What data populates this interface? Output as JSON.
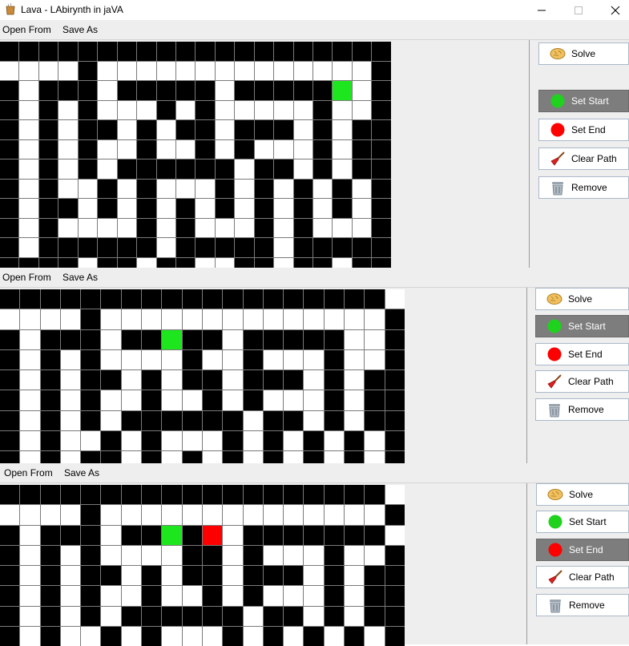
{
  "window": {
    "title": "Lava - LAbirynth in jaVA"
  },
  "menu": {
    "open_label": "Open From",
    "save_label": "Save As"
  },
  "buttons": {
    "solve": "Solve",
    "set_start": "Set Start",
    "set_end": "Set End",
    "clear_path": "Clear Path",
    "remove": "Remove"
  },
  "colors": {
    "wall": "#000000",
    "floor": "#ffffff",
    "start": "#1ee61e",
    "end": "#ff0000",
    "selected_button": "#7d7d7d"
  },
  "icons": {
    "app": "cup-icon",
    "solve": "brain-icon",
    "set_start": "green-dot-icon",
    "set_end": "red-dot-icon",
    "clear_path": "broom-icon",
    "remove": "trash-icon"
  },
  "panels": [
    {
      "selected": "set_start",
      "maze": {
        "rows": [
          "####################",
          "....#..............#",
          "#.###.#####.#####S.#",
          "#.#.#...#.#.....#..#",
          "#.#.##.#.##.###.#.##",
          "#.#.#..#..#.#...#.##",
          "#.#.#.######.##.#.##",
          "#.#..#.#...#.#.#.#.#",
          "#.##.#.#.#.#.#.#.#.#",
          "#.#....#.#...#.#...#",
          "#.######.#####.#####",
          "####.##.##..##.##.##"
        ]
      }
    },
    {
      "selected": "set_start",
      "maze": {
        "rows": [
          "###################.",
          "....#..............#",
          "#.###.##S##.#####..#",
          "#.#.#....#..#...#..#",
          "#.#.##.#.##.###.#.##",
          "#.#.#..#..#.#...#.##",
          "#.#.#.######.##.#.##",
          "#.#..#.#...#.#.#.#.#",
          "#.#.##.#.#.#.#.#.#.#",
          "#.#....#.#...#.#...#"
        ]
      }
    },
    {
      "selected": "set_end",
      "maze": {
        "rows": [
          "###################.",
          "....#..............#",
          "#.###.##S#E.#######.",
          "#.#.#....##.#...#..#",
          "#.#.##.#.##.###.#.##",
          "#.#.#..#..#.#...#.##",
          "#.#.#.######.##.#.##",
          "#.#..#.#...#.#.#.#.#"
        ]
      }
    }
  ]
}
